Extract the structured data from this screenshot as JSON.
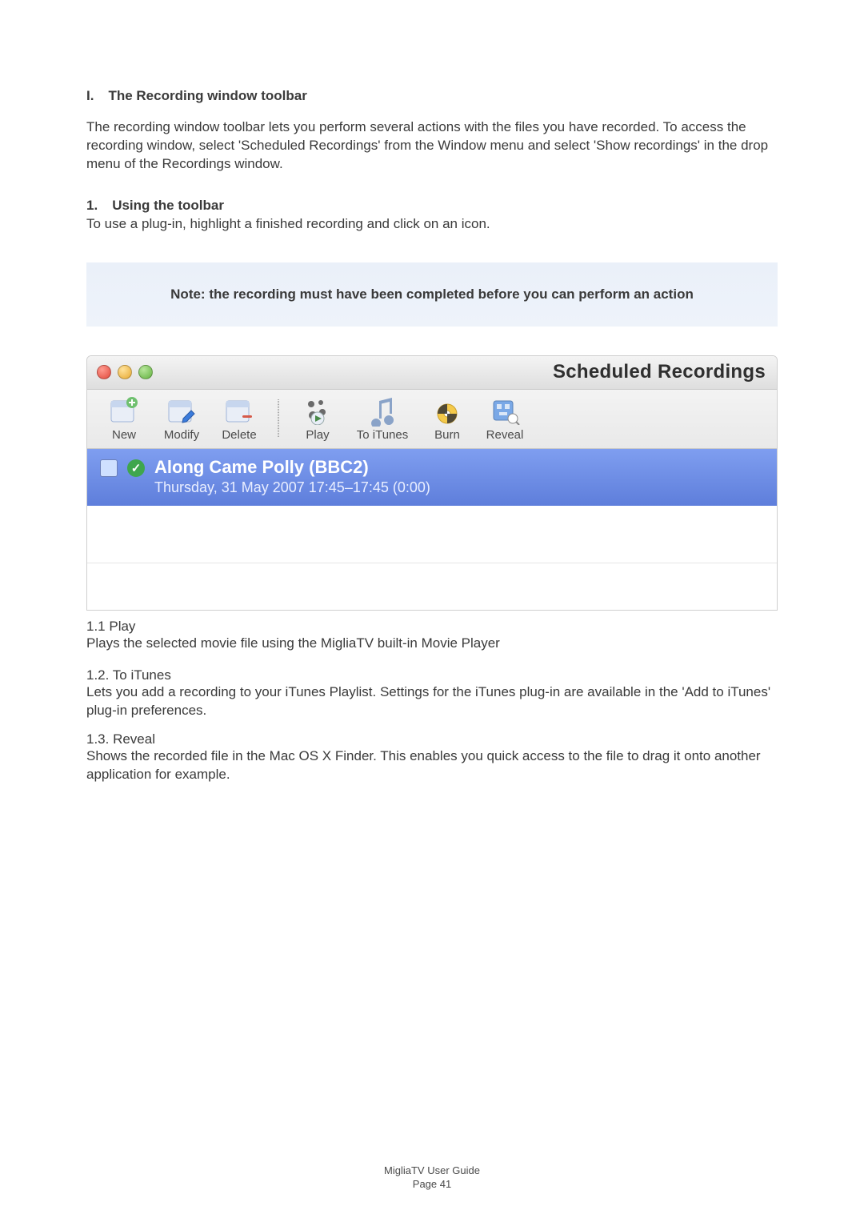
{
  "heading": {
    "num": "I.",
    "text": "The Recording window toolbar"
  },
  "intro": "The recording window toolbar lets you perform several actions with the files you have recorded. To access the recording window, select 'Scheduled Recordings' from the Window menu and select 'Show recordings' in the drop menu of the Recordings window.",
  "sub1": {
    "num": "1.",
    "text": "Using the toolbar"
  },
  "sub1_desc": "To use a plug-in, highlight a finished recording and click on an icon.",
  "note": "Note: the recording must have been completed before you can perform an action",
  "window": {
    "title": "Scheduled Recordings",
    "toolbar": {
      "new": "New",
      "modify": "Modify",
      "delete": "Delete",
      "play": "Play",
      "to_itunes": "To iTunes",
      "burn": "Burn",
      "reveal": "Reveal"
    },
    "row": {
      "title": "Along Came Polly (BBC2)",
      "subtitle": "Thursday, 31 May 2007  17:45–17:45 (0:00)"
    }
  },
  "items": {
    "play": {
      "label": "1.1  Play",
      "desc": "Plays the selected movie file using the MigliaTV built-in Movie Player"
    },
    "to_itunes": {
      "label": "1.2. To iTunes",
      "desc": "Lets you add a recording to your iTunes Playlist. Settings for the iTunes plug-in are available in the 'Add to iTunes' plug-in preferences."
    },
    "reveal": {
      "label": "1.3. Reveal",
      "desc": "Shows the recorded file in the Mac OS X Finder. This enables you quick access to the file to drag it onto another application for example."
    }
  },
  "footer": {
    "line1": "MigliaTV User Guide",
    "line2": "Page 41"
  }
}
